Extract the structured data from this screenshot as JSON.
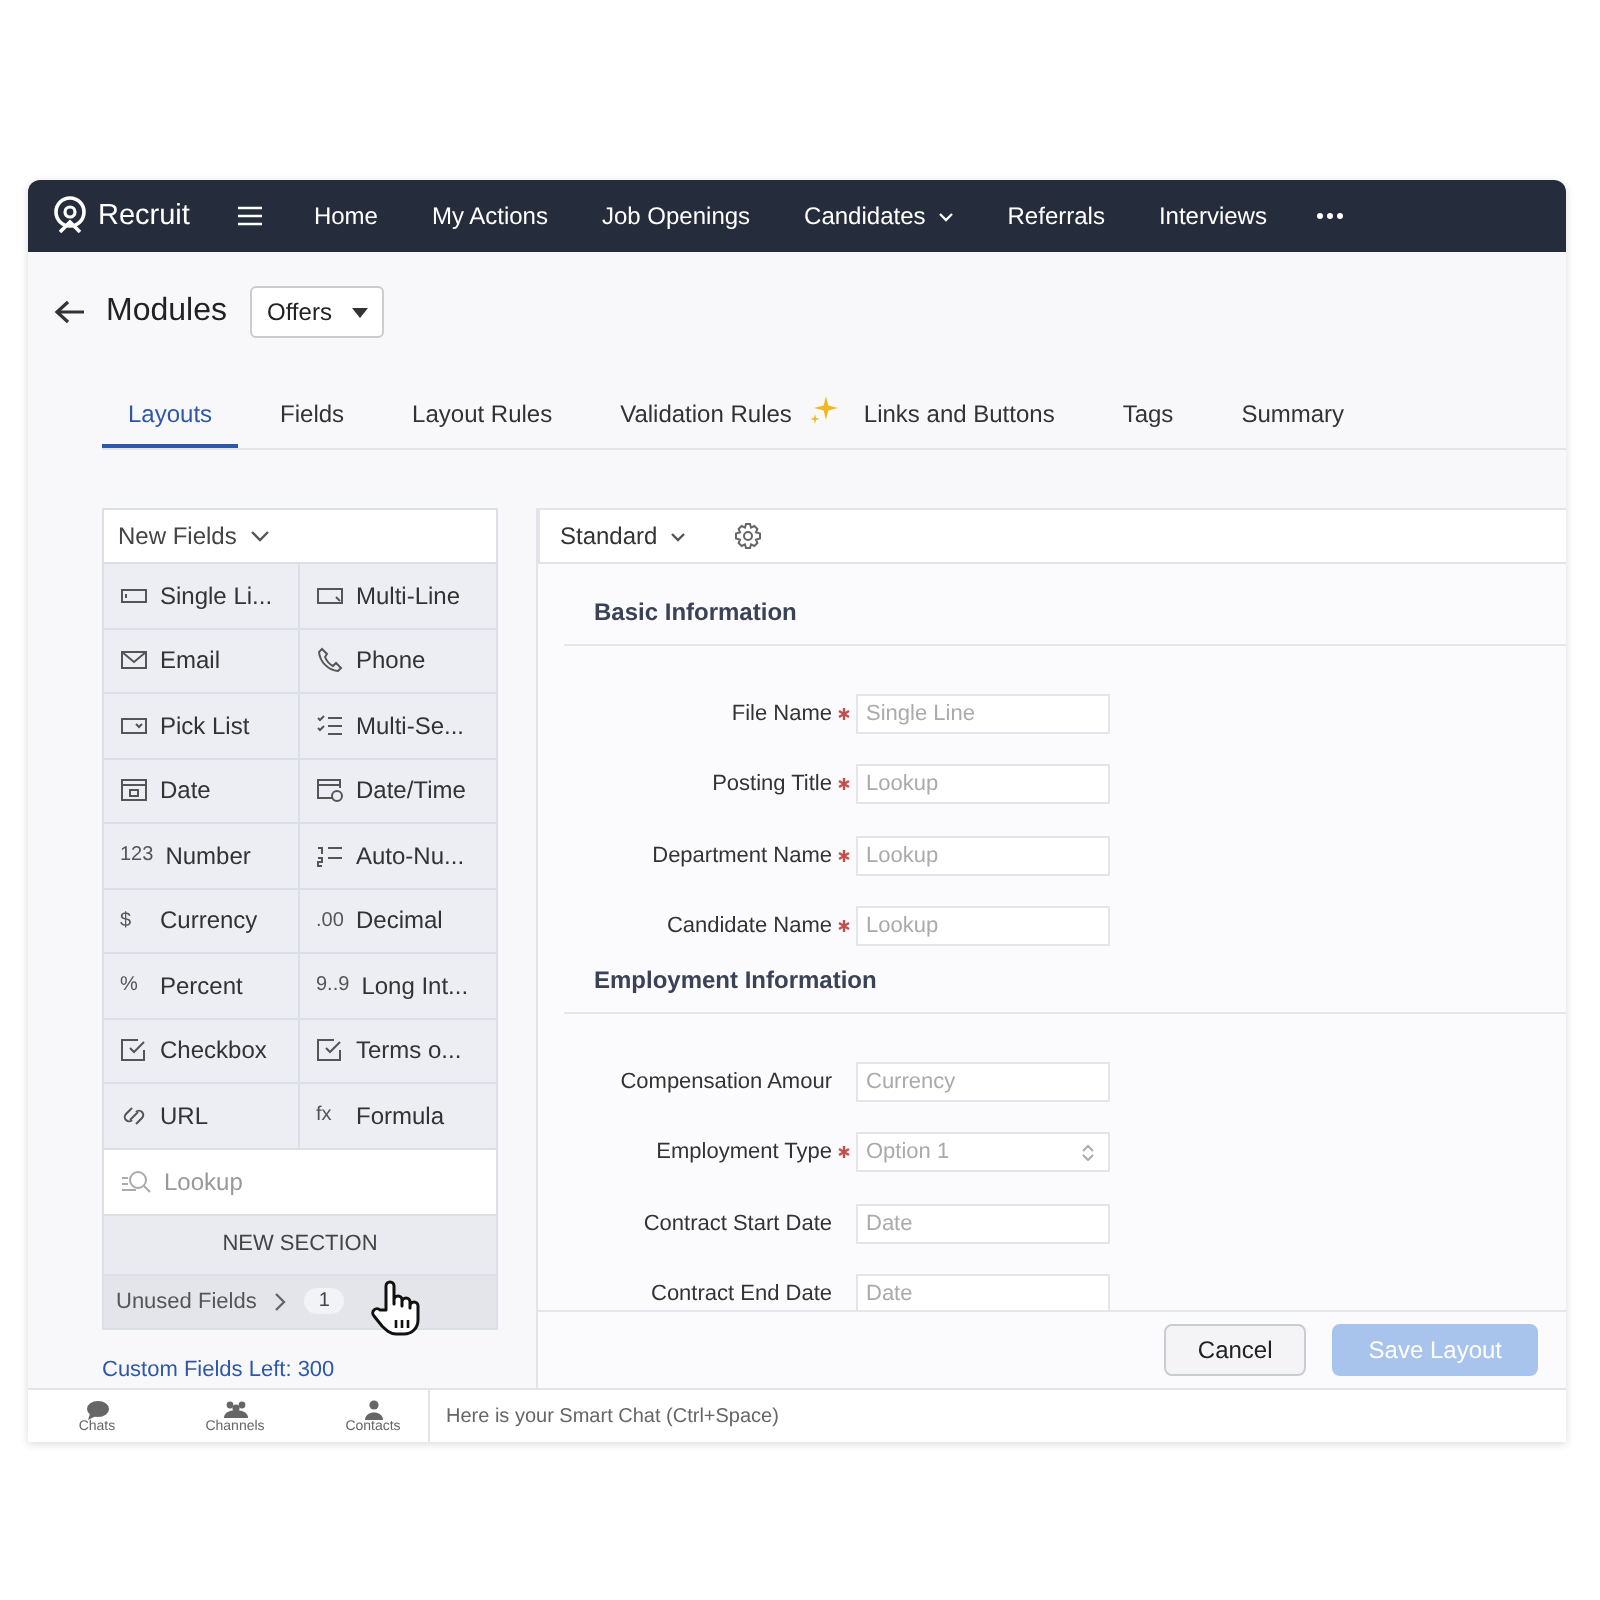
{
  "nav": {
    "brand": "Recruit",
    "items": [
      {
        "label": "Home",
        "dropdown": false
      },
      {
        "label": "My Actions",
        "dropdown": false
      },
      {
        "label": "Job Openings",
        "dropdown": false
      },
      {
        "label": "Candidates",
        "dropdown": true
      },
      {
        "label": "Referrals",
        "dropdown": false
      },
      {
        "label": "Interviews",
        "dropdown": false
      }
    ]
  },
  "header": {
    "title": "Modules",
    "module_select": "Offers"
  },
  "tabs": [
    {
      "label": "Layouts",
      "selected": true,
      "new": false
    },
    {
      "label": "Fields",
      "selected": false,
      "new": false
    },
    {
      "label": "Layout Rules",
      "selected": false,
      "new": false
    },
    {
      "label": "Validation Rules",
      "selected": false,
      "new": true
    },
    {
      "label": "Links and Buttons",
      "selected": false,
      "new": false
    },
    {
      "label": "Tags",
      "selected": false,
      "new": false
    },
    {
      "label": "Summary",
      "selected": false,
      "new": false
    }
  ],
  "palette": {
    "title": "New Fields",
    "fields": [
      {
        "label": "Single Li...",
        "kind": "single-line"
      },
      {
        "label": "Multi-Line",
        "kind": "multi-line"
      },
      {
        "label": "Email",
        "kind": "email"
      },
      {
        "label": "Phone",
        "kind": "phone"
      },
      {
        "label": "Pick List",
        "kind": "picklist"
      },
      {
        "label": "Multi-Se...",
        "kind": "multiselect"
      },
      {
        "label": "Date",
        "kind": "date"
      },
      {
        "label": "Date/Time",
        "kind": "datetime"
      },
      {
        "label": "Number",
        "kind": "glyph",
        "glyph": "123"
      },
      {
        "label": "Auto-Nu...",
        "kind": "autonumber"
      },
      {
        "label": "Currency",
        "kind": "glyph",
        "glyph": "$"
      },
      {
        "label": "Decimal",
        "kind": "glyph",
        "glyph": ".00"
      },
      {
        "label": "Percent",
        "kind": "glyph",
        "glyph": "%"
      },
      {
        "label": "Long Int...",
        "kind": "glyph",
        "glyph": "9..9"
      },
      {
        "label": "Checkbox",
        "kind": "checkbox"
      },
      {
        "label": "Terms o...",
        "kind": "checkbox"
      },
      {
        "label": "URL",
        "kind": "url"
      },
      {
        "label": "Formula",
        "kind": "glyph",
        "glyph": "fx"
      }
    ],
    "lookup": {
      "label": "Lookup",
      "disabled": true
    },
    "new_section": "NEW SECTION",
    "unused": {
      "label": "Unused Fields",
      "count": "1"
    },
    "custom_left": "Custom Fields Left: 300"
  },
  "layout": {
    "name": "Standard",
    "sections": [
      {
        "title": "Basic Information",
        "rows": [
          {
            "label": "File Name",
            "required": true,
            "placeholder": "Single Line",
            "kind": "text"
          },
          {
            "label": "Posting Title",
            "required": true,
            "placeholder": "Lookup",
            "kind": "text"
          },
          {
            "label": "Department Name",
            "required": true,
            "placeholder": "Lookup",
            "kind": "text"
          },
          {
            "label": "Candidate Name",
            "required": true,
            "placeholder": "Lookup",
            "kind": "text"
          }
        ]
      },
      {
        "title": "Employment Information",
        "rows": [
          {
            "label": "Compensation Amour",
            "required": false,
            "placeholder": "Currency",
            "kind": "text"
          },
          {
            "label": "Employment Type",
            "required": true,
            "placeholder": "Option 1",
            "kind": "select"
          },
          {
            "label": "Contract Start Date",
            "required": false,
            "placeholder": "Date",
            "kind": "text"
          },
          {
            "label": "Contract End Date",
            "required": false,
            "placeholder": "Date",
            "kind": "text"
          }
        ]
      }
    ],
    "buttons": [
      {
        "label": "Cancel",
        "disabled": false,
        "primary": false
      },
      {
        "label": "Save Layout",
        "disabled": true,
        "primary": true
      }
    ]
  },
  "bottom_bar": {
    "items": [
      {
        "label": "Chats",
        "kind": "chats"
      },
      {
        "label": "Channels",
        "kind": "channels"
      },
      {
        "label": "Contacts",
        "kind": "contacts"
      }
    ],
    "chat_hint": "Here is your Smart Chat (Ctrl+Space)"
  }
}
